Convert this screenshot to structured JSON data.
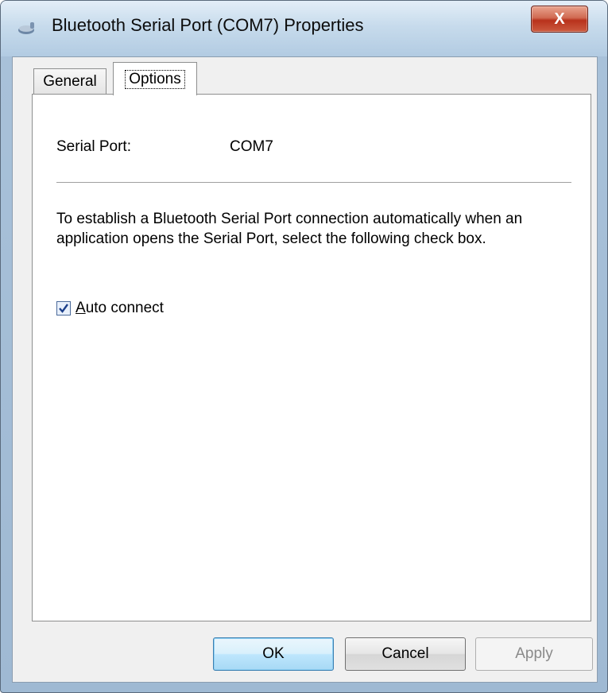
{
  "window": {
    "title": "Bluetooth Serial Port (COM7) Properties",
    "close_glyph": "X"
  },
  "tabs": [
    {
      "label": "General",
      "selected": false
    },
    {
      "label": "Options",
      "selected": true
    }
  ],
  "options": {
    "serial_port_label": "Serial Port:",
    "serial_port_value": "COM7",
    "description": "To establish a Bluetooth Serial Port connection automatically when an application opens the Serial Port, select the following check box.",
    "auto_connect": {
      "mnemonic": "A",
      "rest": "uto connect",
      "checked": true
    }
  },
  "buttons": {
    "ok": "OK",
    "cancel": "Cancel",
    "apply": "Apply"
  },
  "icons": {
    "title": "bluetooth-device-icon",
    "close": "close-icon",
    "check": "check-icon"
  },
  "colors": {
    "close_button": "#c0392b",
    "checkbox_check": "#1c3f8a",
    "disabled_text": "#8a8a8a"
  }
}
